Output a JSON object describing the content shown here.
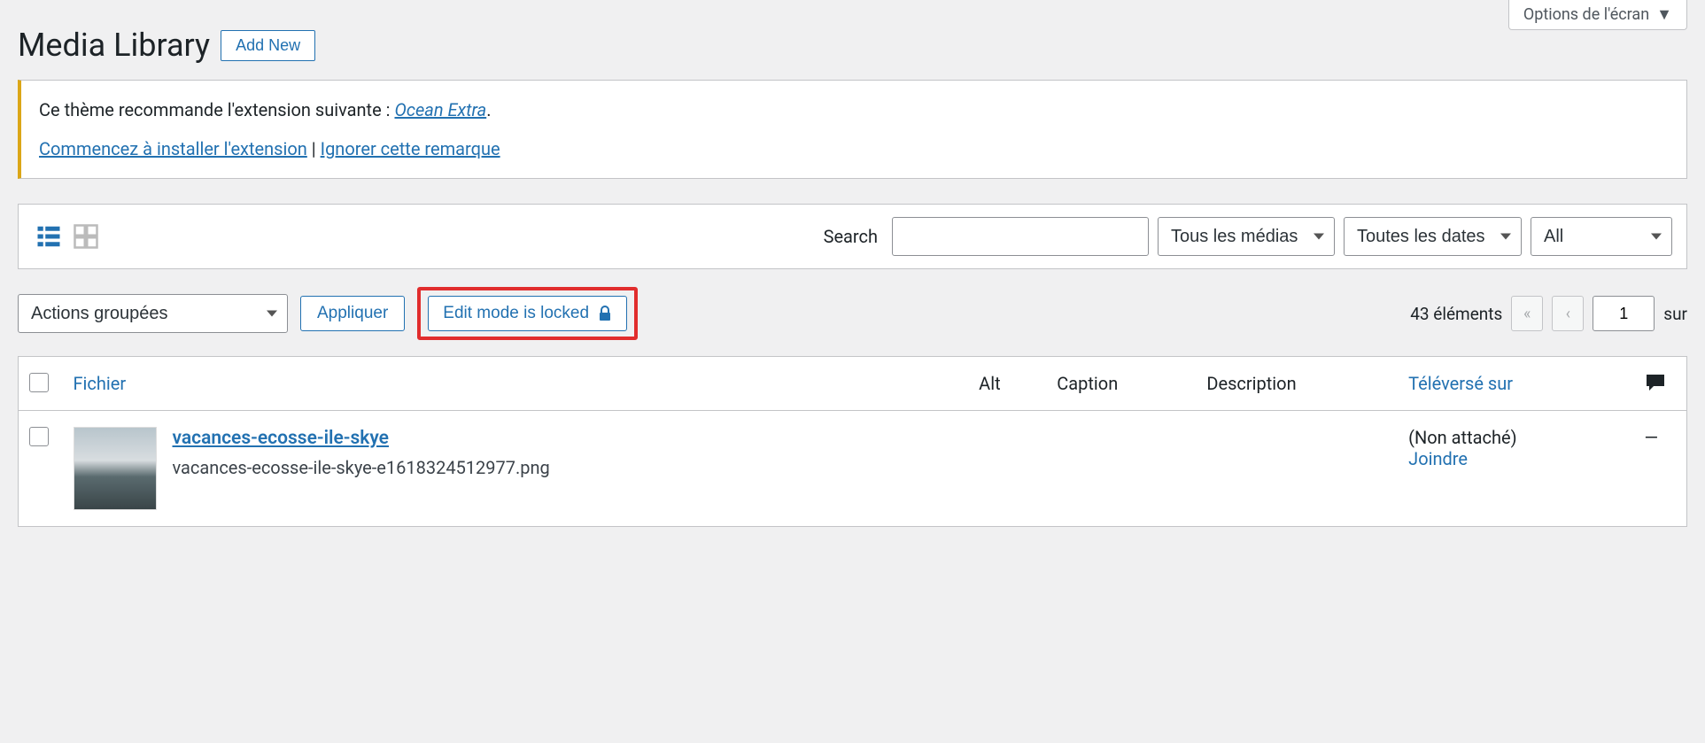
{
  "screen_options": {
    "label": "Options de l'écran"
  },
  "header": {
    "title": "Media Library",
    "add_new": "Add New"
  },
  "notice": {
    "prefix": "Ce thème recommande l'extension suivante : ",
    "plugin": "Ocean Extra",
    "suffix": ".",
    "install": "Commencez à installer l'extension",
    "separator": " | ",
    "dismiss": "Ignorer cette remarque"
  },
  "filter": {
    "search_label": "Search",
    "media_type": "Tous les médias",
    "dates": "Toutes les dates",
    "all": "All"
  },
  "actions": {
    "bulk": "Actions groupées",
    "apply": "Appliquer",
    "locked": "Edit mode is locked"
  },
  "pagination": {
    "count_label": "43 éléments",
    "current": "1",
    "sur": "sur"
  },
  "columns": {
    "file": "Fichier",
    "alt": "Alt",
    "caption": "Caption",
    "description": "Description",
    "uploaded": "Téléversé sur"
  },
  "row": {
    "title": "vacances-ecosse-ile-skye",
    "filename": "vacances-ecosse-ile-skye-e1618324512977.png",
    "uploaded": "(Non attaché)",
    "attach": "Joindre",
    "comments": "—"
  }
}
